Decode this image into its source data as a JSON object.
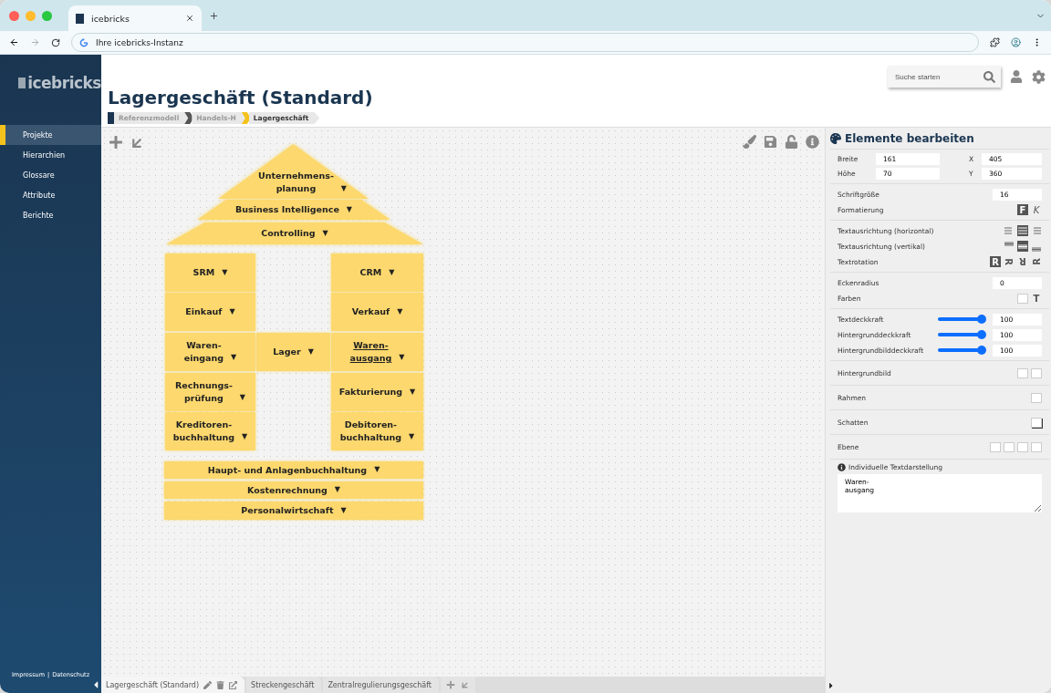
{
  "browser": {
    "tab_title": "icebricks",
    "address": "Ihre icebricks-Instanz"
  },
  "sidebar": {
    "logo": "icebricks",
    "items": [
      {
        "label": "Projekte",
        "selected": true
      },
      {
        "label": "Hierarchien",
        "selected": false
      },
      {
        "label": "Glossare",
        "selected": false
      },
      {
        "label": "Attribute",
        "selected": false
      },
      {
        "label": "Berichte",
        "selected": false
      }
    ],
    "footer_links": [
      "Impressum",
      "Datenschutz"
    ],
    "footer_separator": "|"
  },
  "header": {
    "title": "Lagergeschäft (Standard)",
    "search": {
      "placeholder": "Suche starten"
    },
    "breadcrumbs": [
      {
        "label": "Referenzmodell",
        "selected": false
      },
      {
        "label": "Handels-H",
        "selected": false
      },
      {
        "label": "Lagergeschäft",
        "selected": true
      }
    ]
  },
  "diagram": {
    "nodes": [
      {
        "kind": "roof",
        "label": "Unternehmens-\nplanung",
        "arrow": "▼",
        "selected": false
      },
      {
        "kind": "trapezoid",
        "label": "Business Intelligence",
        "arrow": "▼",
        "selected": false
      },
      {
        "kind": "trapezoid",
        "label": "Controlling",
        "arrow": "▼",
        "selected": false
      },
      {
        "kind": "box",
        "label": "SRM",
        "arrow": "▼",
        "selected": false
      },
      {
        "kind": "box",
        "label": "Einkauf",
        "arrow": "▼",
        "selected": false
      },
      {
        "kind": "box",
        "label": "Waren-\neingang",
        "arrow": "▼",
        "selected": false
      },
      {
        "kind": "box",
        "label": "Rechnungs-\nprüfung",
        "arrow": "▼",
        "selected": false
      },
      {
        "kind": "box",
        "label": "Kreditoren-\nbuchhaltung",
        "arrow": "▼",
        "selected": false
      },
      {
        "kind": "box",
        "label": "Lager",
        "arrow": "▼",
        "selected": false
      },
      {
        "kind": "box",
        "label": "CRM",
        "arrow": "▼",
        "selected": false
      },
      {
        "kind": "box",
        "label": "Verkauf",
        "arrow": "▼",
        "selected": false
      },
      {
        "kind": "box",
        "label": "Waren-\nausgang",
        "arrow": "▼",
        "selected": true
      },
      {
        "kind": "box",
        "label": "Fakturierung",
        "arrow": "▼",
        "selected": false
      },
      {
        "kind": "box",
        "label": "Debitoren-\nbuchhaltung",
        "arrow": "▼",
        "selected": false
      },
      {
        "kind": "bar",
        "label": "Haupt- und Anlagenbuchhaltung",
        "arrow": "▼",
        "selected": false
      },
      {
        "kind": "bar",
        "label": "Kostenrechnung",
        "arrow": "▼",
        "selected": false
      },
      {
        "kind": "bar",
        "label": "Personalwirtschaft",
        "arrow": "▼",
        "selected": false
      }
    ]
  },
  "panel": {
    "title": "Elemente bearbeiten",
    "size": [
      {
        "label": "Breite",
        "value": "161"
      },
      {
        "label": "X",
        "value": "405"
      },
      {
        "label": "Höhe",
        "value": "70"
      },
      {
        "label": "Y",
        "value": "360"
      }
    ],
    "font_size": {
      "label": "Schriftgröße",
      "value": "16"
    },
    "formatting": {
      "label": "Formatierung",
      "bold": {
        "glyph": "F",
        "on": true
      },
      "italic": {
        "glyph": "K",
        "on": false
      }
    },
    "align_h": {
      "label": "Textausrichtung (horizontal)",
      "options": [
        {
          "selected": false
        },
        {
          "selected": true
        },
        {
          "selected": false
        }
      ]
    },
    "align_v": {
      "label": "Textausrichtung (vertikal)",
      "options": [
        {
          "selected": false
        },
        {
          "selected": true
        },
        {
          "selected": false
        }
      ]
    },
    "rotation": {
      "label": "Textrotation",
      "options": [
        {
          "glyph": "R",
          "selected": true
        },
        {
          "glyph": "R",
          "selected": false
        },
        {
          "glyph": "R",
          "selected": false
        },
        {
          "glyph": "R",
          "selected": false
        }
      ]
    },
    "corner": {
      "label": "Eckenradius",
      "value": "0"
    },
    "colors": {
      "label": "Farben",
      "text_glyph": "T"
    },
    "opacities": [
      {
        "label": "Textdeckkraft",
        "level": 1,
        "value": "100"
      },
      {
        "label": "Hintergrunddeckkraft",
        "level": 1,
        "value": "100"
      },
      {
        "label": "Hintergrundbilddeckkraft",
        "level": 1,
        "value": "100"
      }
    ],
    "options": [
      {
        "label": "Hintergrundbild",
        "kind": "image"
      },
      {
        "label": "Rahmen",
        "kind": "border"
      },
      {
        "label": "Schatten",
        "kind": "shadow"
      },
      {
        "label": "Ebene",
        "kind": "layer"
      }
    ],
    "custom_text": {
      "label": "Individuelle Textdarstellung",
      "value": "Waren-\nausgang"
    }
  },
  "bottom_tabs": [
    {
      "label": "Lagergeschäft (Standard)",
      "selected": true
    },
    {
      "label": "Streckengeschäft",
      "selected": false
    },
    {
      "label": "Zentralregulierungsgeschäft",
      "selected": false
    }
  ]
}
